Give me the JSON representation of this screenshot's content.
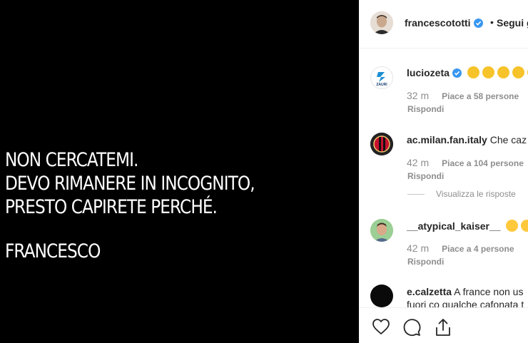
{
  "post": {
    "lines": [
      "NON CERCATEMI.",
      "DEVO RIMANERE IN INCOGNITO,",
      "PRESTO CAPIRETE PERCHÉ."
    ],
    "signature": "FRANCESCO"
  },
  "header": {
    "username": "francescototti",
    "separator": "•",
    "follow_label": "Segui g"
  },
  "comments": [
    {
      "username": "luciozeta",
      "text": "",
      "time": "32 m",
      "likes": "Piace a 58 persone",
      "reply": "Rispondi",
      "verified": true,
      "emoji_count": 5,
      "avatar_text": "ZAURI"
    },
    {
      "username": "ac.milan.fan.italy",
      "text": "Che caz",
      "time": "42 m",
      "likes": "Piace a 104 persone",
      "reply": "Rispondi",
      "view_replies": "Visualizza le risposte"
    },
    {
      "username": "__atypical_kaiser__",
      "text": "",
      "time": "42 m",
      "likes": "Piace a 4 persone",
      "reply": "Rispondi",
      "emoji_count": 2
    },
    {
      "username": "e.calzetta",
      "text": "A france non us",
      "text2": "fuori co qualche cafonata t"
    }
  ],
  "icons": [
    "heart-icon",
    "comment-icon",
    "share-icon",
    "verified-icon"
  ]
}
